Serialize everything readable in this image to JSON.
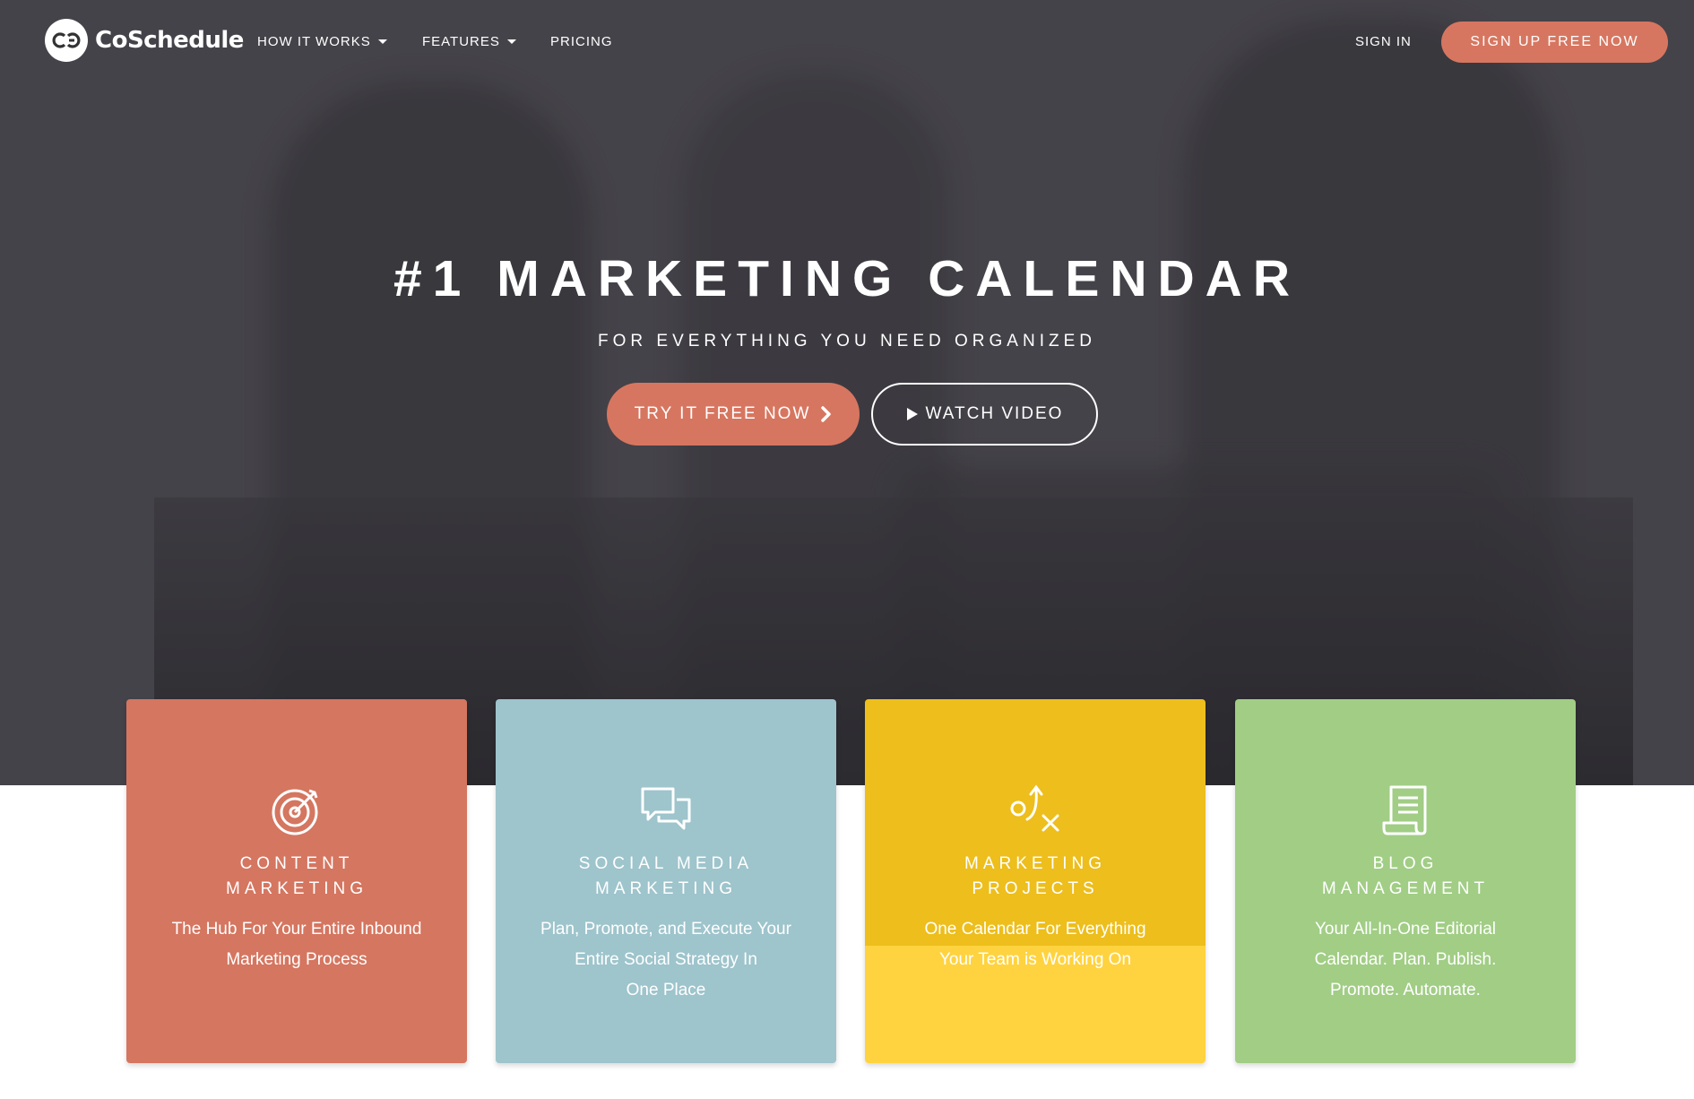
{
  "brand": {
    "name": "CoSchedule"
  },
  "nav": {
    "items": [
      {
        "label": "HOW IT WORKS",
        "dropdown": true
      },
      {
        "label": "FEATURES",
        "dropdown": true
      },
      {
        "label": "PRICING",
        "dropdown": false
      }
    ],
    "sign_in": "SIGN IN",
    "signup": "SIGN UP FREE NOW"
  },
  "hero": {
    "headline": "#1 MARKETING CALENDAR",
    "subheadline": "FOR EVERYTHING YOU NEED ORGANIZED",
    "try_button": "TRY IT FREE NOW",
    "watch_button": "WATCH VIDEO"
  },
  "cards": [
    {
      "title_lines": [
        "CONTENT",
        "MARKETING"
      ],
      "desc_lines": [
        "The Hub For Your Entire Inbound",
        "Marketing Process"
      ],
      "icon": "target-icon",
      "color": "#d57660"
    },
    {
      "title_lines": [
        "SOCIAL MEDIA",
        "MARKETING"
      ],
      "desc_lines": [
        "Plan, Promote, and Execute Your",
        "Entire Social Strategy In",
        "One Place"
      ],
      "icon": "chat-bubbles-icon",
      "color": "#9ec4cc"
    },
    {
      "title_lines": [
        "MARKETING",
        "PROJECTS"
      ],
      "desc_lines": [
        "One Calendar For Everything",
        "Your Team is Working On"
      ],
      "icon": "strategy-icon",
      "color": "#edbe1c"
    },
    {
      "title_lines": [
        "BLOG",
        "MANAGEMENT"
      ],
      "desc_lines": [
        "Your All-In-One Editorial",
        "Calendar. Plan. Publish.",
        "Promote. Automate."
      ],
      "icon": "document-icon",
      "color": "#a1cd85"
    }
  ],
  "colors": {
    "accent": "#d77660",
    "hero_bg": "#504e55"
  }
}
